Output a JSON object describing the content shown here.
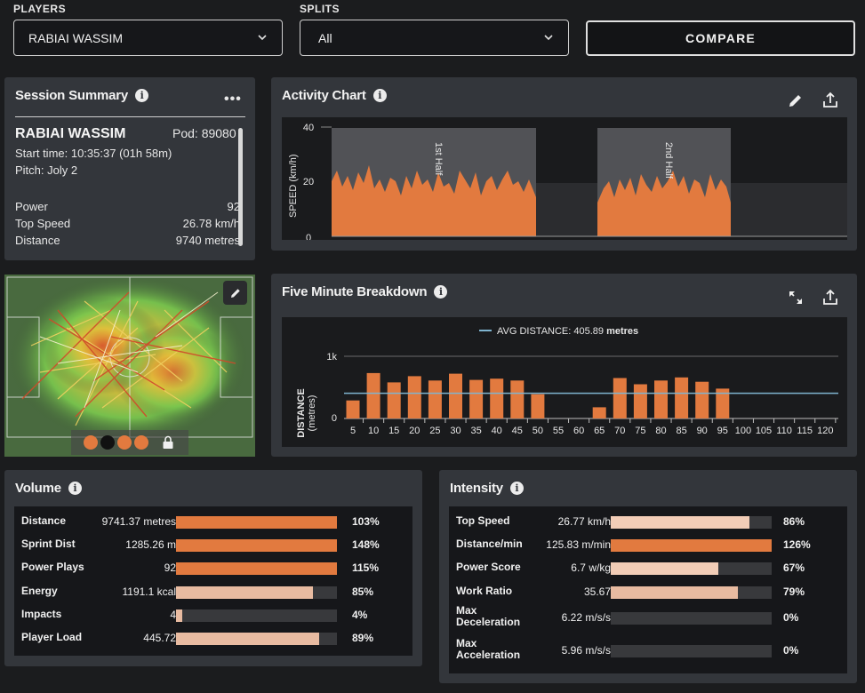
{
  "top": {
    "players_label": "PLAYERS",
    "player_value": "RABIAI WASSIM",
    "splits_label": "SPLITS",
    "splits_value": "All",
    "compare_label": "COMPARE"
  },
  "session": {
    "title": "Session Summary",
    "name": "RABIAI WASSIM",
    "pod": "Pod: 89080",
    "start": "Start time: 10:35:37 (01h 58m)",
    "pitch": "Pitch: Joly 2",
    "rows": [
      {
        "label": "Power",
        "value": "92"
      },
      {
        "label": "Top Speed",
        "value": "26.78 km/h"
      },
      {
        "label": "Distance",
        "value": "9740 metres"
      }
    ]
  },
  "activity": {
    "title": "Activity Chart",
    "ylabel": "SPEED (km/h)",
    "yticks": [
      "40",
      "20",
      "0"
    ],
    "half1": "1st Half",
    "half2": "2nd Half"
  },
  "five": {
    "title": "Five Minute Breakdown",
    "legend_prefix": "AVG DISTANCE: 405.89",
    "legend_unit": "metres",
    "ylabel": "DISTANCE",
    "ylabel2": "(metres)",
    "yticks": [
      "1k",
      "0"
    ]
  },
  "chart_data": {
    "type": "bar",
    "categories": [
      "5",
      "10",
      "15",
      "20",
      "25",
      "30",
      "35",
      "40",
      "45",
      "50",
      "55",
      "60",
      "65",
      "70",
      "75",
      "80",
      "85",
      "90",
      "95",
      "100",
      "105",
      "110",
      "115",
      "120"
    ],
    "values": [
      290,
      730,
      580,
      680,
      610,
      720,
      620,
      640,
      610,
      390,
      0,
      0,
      180,
      650,
      550,
      610,
      660,
      590,
      480,
      0,
      0,
      0,
      0,
      0
    ],
    "average": 405.89,
    "ylim": [
      0,
      1000
    ],
    "ylabel": "DISTANCE (metres)",
    "xlabel": ""
  },
  "volume": {
    "title": "Volume",
    "rows": [
      {
        "label": "Distance",
        "value": "9741.37 metres",
        "pct": "103%",
        "fill": 1.0,
        "color": "#e27a3f"
      },
      {
        "label": "Sprint Dist",
        "value": "1285.26 m",
        "pct": "148%",
        "fill": 1.0,
        "color": "#e27a3f"
      },
      {
        "label": "Power Plays",
        "value": "92",
        "pct": "115%",
        "fill": 1.0,
        "color": "#e27a3f"
      },
      {
        "label": "Energy",
        "value": "1191.1 kcal",
        "pct": "85%",
        "fill": 0.85,
        "color": "#e8bba1"
      },
      {
        "label": "Impacts",
        "value": "4",
        "pct": "4%",
        "fill": 0.04,
        "color": "#e8bba1"
      },
      {
        "label": "Player Load",
        "value": "445.72",
        "pct": "89%",
        "fill": 0.89,
        "color": "#e8bba1"
      }
    ]
  },
  "intensity": {
    "title": "Intensity",
    "rows": [
      {
        "label": "Top Speed",
        "label2": "",
        "value": "26.77 km/h",
        "pct": "86%",
        "fill": 0.86,
        "color": "#f2cdb7"
      },
      {
        "label": "Distance/min",
        "label2": "",
        "value": "125.83 m/min",
        "pct": "126%",
        "fill": 1.0,
        "color": "#e27a3f"
      },
      {
        "label": "Power Score",
        "label2": "",
        "value": "6.7 w/kg",
        "pct": "67%",
        "fill": 0.67,
        "color": "#f2cdb7"
      },
      {
        "label": "Work Ratio",
        "label2": "",
        "value": "35.67",
        "pct": "79%",
        "fill": 0.79,
        "color": "#e8bba1"
      },
      {
        "label": "Max",
        "label2": "Deceleration",
        "value": "6.22 m/s/s",
        "pct": "0%",
        "fill": 0,
        "color": "#e8bba1"
      },
      {
        "label": "Max",
        "label2": "Acceleration",
        "value": "5.96 m/s/s",
        "pct": "0%",
        "fill": 0,
        "color": "#e8bba1"
      }
    ]
  },
  "colors": {
    "accent": "#e27a3f",
    "light": "#e8bba1",
    "avg_line": "#7fb4cf"
  }
}
